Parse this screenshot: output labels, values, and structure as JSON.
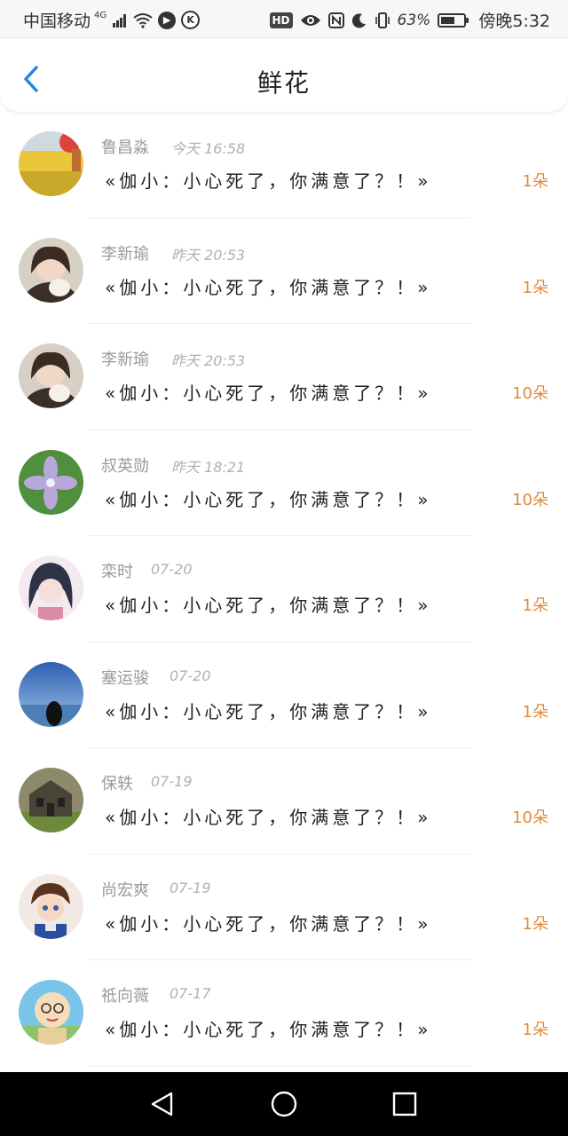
{
  "status_bar": {
    "carrier": "中国移动",
    "network": "4G",
    "battery_percent": "63%",
    "battery_level": 0.63,
    "hd_badge": "HD",
    "k_badge": "K",
    "time": "傍晚5:32",
    "icons": [
      "signal-icon",
      "wifi-icon",
      "play-icon",
      "k-icon",
      "hd-icon",
      "eye-icon",
      "nfc-icon",
      "moon-icon",
      "vibrate-icon",
      "battery-icon"
    ]
  },
  "header": {
    "title": "鲜花",
    "back_icon": "chevron-left-icon",
    "accent": "#1e88e5"
  },
  "list": {
    "items": [
      {
        "name": "鲁昌淼",
        "time": "今天 16:58",
        "message": "«伽小：小心死了，你满意了？！»",
        "count": "1朵",
        "avatar": "field-avatar"
      },
      {
        "name": "李新瑜",
        "time": "昨天 20:53",
        "message": "«伽小：小心死了，你满意了？！»",
        "count": "1朵",
        "avatar": "girl-avatar"
      },
      {
        "name": "李新瑜",
        "time": "昨天 20:53",
        "message": "«伽小：小心死了，你满意了？！»",
        "count": "10朵",
        "avatar": "girl-avatar"
      },
      {
        "name": "叔英勋",
        "time": "昨天 18:21",
        "message": "«伽小：小心死了，你满意了？！»",
        "count": "10朵",
        "avatar": "flower-avatar"
      },
      {
        "name": "栾时",
        "time": "07-20",
        "message": "«伽小：小心死了，你满意了？！»",
        "count": "1朵",
        "avatar": "anime-girl-avatar"
      },
      {
        "name": "塞运骏",
        "time": "07-20",
        "message": "«伽小：小心死了，你满意了？！»",
        "count": "1朵",
        "avatar": "sea-avatar"
      },
      {
        "name": "保轶",
        "time": "07-19",
        "message": "«伽小：小心死了，你满意了？！»",
        "count": "10朵",
        "avatar": "house-avatar"
      },
      {
        "name": "尚宏爽",
        "time": "07-19",
        "message": "«伽小：小心死了，你满意了？！»",
        "count": "1朵",
        "avatar": "anime-boy-avatar"
      },
      {
        "name": "祗向薇",
        "time": "07-17",
        "message": "«伽小：小心死了，你满意了？！»",
        "count": "1朵",
        "avatar": "cartoon-avatar"
      }
    ],
    "count_color": "#e08a3a"
  },
  "nav_bar": {
    "buttons": [
      "back-triangle-icon",
      "home-circle-icon",
      "recents-square-icon"
    ]
  }
}
